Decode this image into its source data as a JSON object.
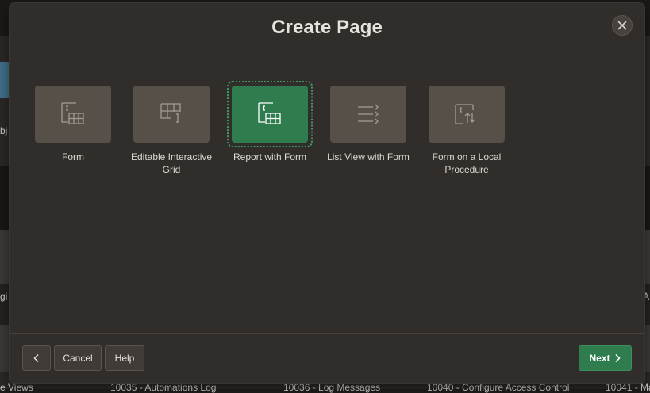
{
  "dialog": {
    "title": "Create Page",
    "close_icon": "close-icon"
  },
  "options": [
    {
      "label": "Form",
      "icon": "form-icon",
      "selected": false
    },
    {
      "label": "Editable Interactive Grid",
      "icon": "editable-grid-icon",
      "selected": false
    },
    {
      "label": "Report with Form",
      "icon": "report-with-form-icon",
      "selected": true
    },
    {
      "label": "List View with Form",
      "icon": "list-view-icon",
      "selected": false
    },
    {
      "label": "Form on a Local Procedure",
      "icon": "procedure-form-icon",
      "selected": false
    }
  ],
  "footer": {
    "back_icon": "chevron-left-icon",
    "cancel_label": "Cancel",
    "help_label": "Help",
    "next_label": "Next",
    "next_icon": "chevron-right-icon"
  },
  "background": {
    "left_fragment_1": "bj",
    "left_fragment_2": "gi",
    "right_fragment": "A",
    "bottom_row": [
      "e Views",
      "10035 - Automations Log",
      "10036 - Log Messages",
      "10040 - Configure Access Control",
      "10041 - Ma"
    ]
  },
  "colors": {
    "accent": "#2f7d4f",
    "dialog_bg": "#312d2a",
    "tile_bg": "#565049"
  }
}
